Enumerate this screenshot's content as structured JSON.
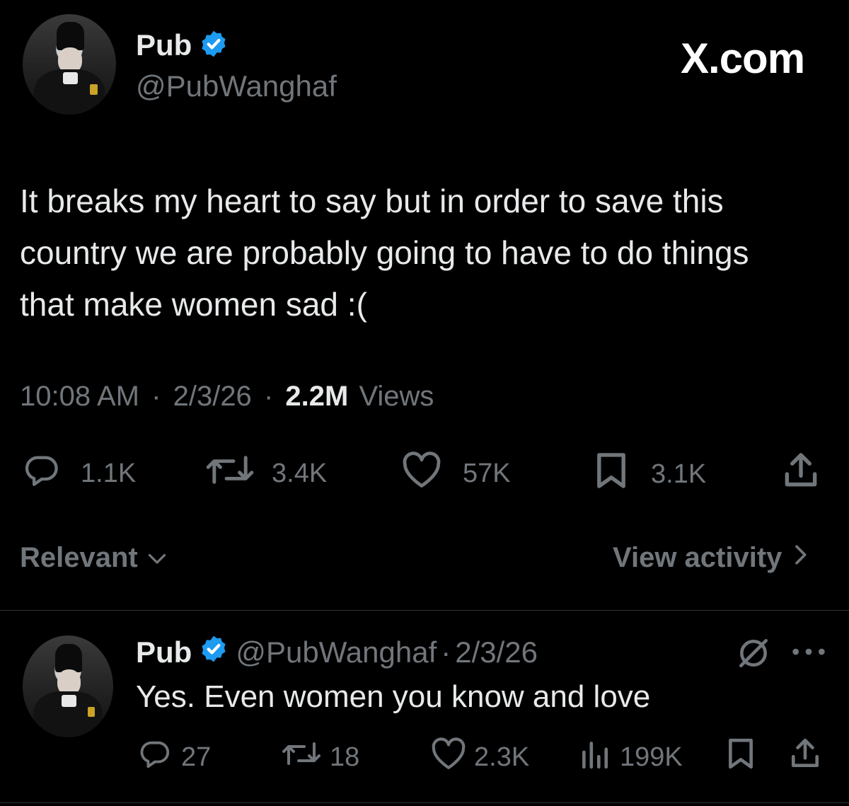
{
  "watermark": "X.com",
  "tweet": {
    "display_name": "Pub",
    "handle": "@PubWanghaf",
    "text": "It breaks my heart to say but in order to save this country we are probably going to have to do things that make women sad :(",
    "time": "10:08 AM",
    "separator": "·",
    "date": "2/3/26",
    "views_count": "2.2M",
    "views_label": "Views",
    "actions": {
      "replies": "1.1K",
      "reposts": "3.4K",
      "likes": "57K",
      "bookmarks": "3.1K"
    }
  },
  "filter_bar": {
    "sort_label": "Relevant",
    "activity_label": "View activity"
  },
  "reply": {
    "display_name": "Pub",
    "handle": "@PubWanghaf",
    "separator": "·",
    "date": "2/3/26",
    "text": "Yes. Even women you know and love",
    "actions": {
      "replies": "27",
      "reposts": "18",
      "likes": "2.3K",
      "views": "199K"
    }
  },
  "colors": {
    "background": "#000000",
    "text": "#e7e9ea",
    "muted": "#71767b",
    "verified": "#1d9bf0",
    "divider": "#2f3336"
  }
}
